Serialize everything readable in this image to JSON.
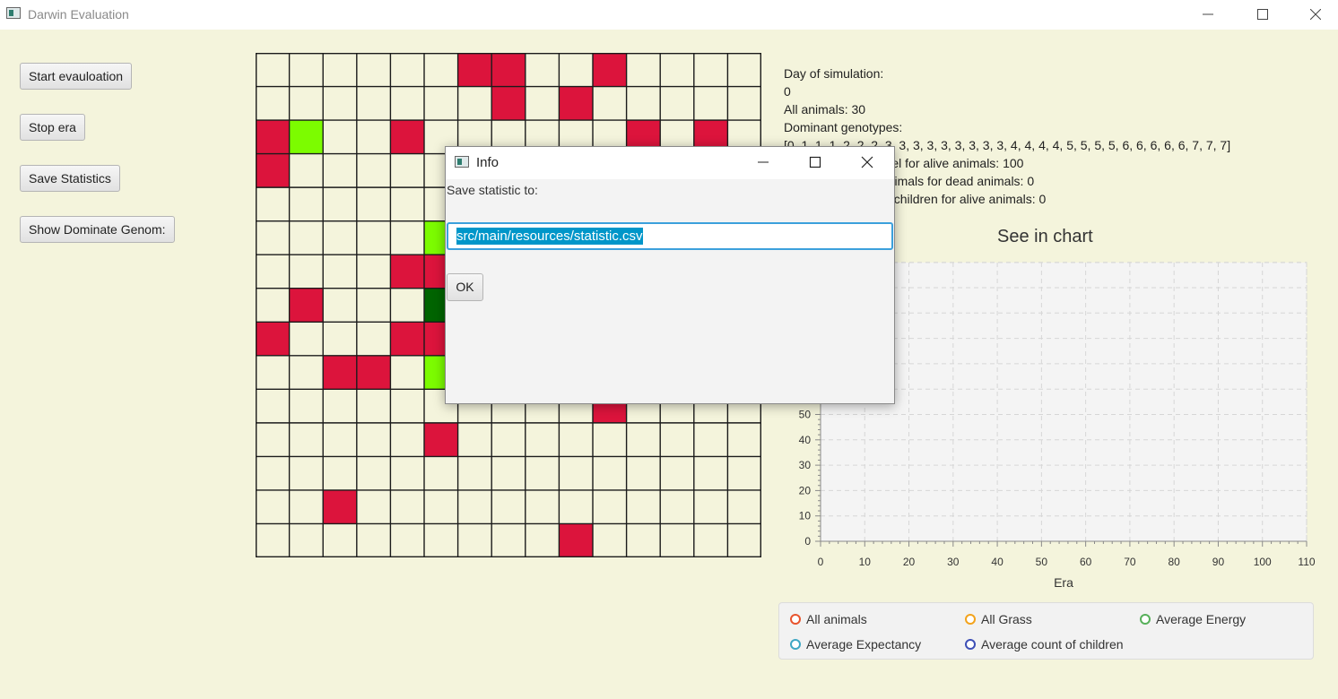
{
  "window": {
    "title": "Darwin Evaluation"
  },
  "controls": {
    "start_label": "Start evauloation",
    "stop_label": "Stop era",
    "save_label": "Save Statistics",
    "show_genom_label": "Show Dominate Genom:"
  },
  "map": {
    "columns": 15,
    "rows": 15,
    "colors": {
      "empty": "#f4f4dc",
      "animal": "#dc143c",
      "grass": "#7cfc00",
      "animal_dark": "#006400"
    },
    "animals": [
      [
        6,
        0
      ],
      [
        7,
        0
      ],
      [
        10,
        0
      ],
      [
        7,
        1
      ],
      [
        9,
        1
      ],
      [
        0,
        2
      ],
      [
        4,
        2
      ],
      [
        11,
        2
      ],
      [
        13,
        2
      ],
      [
        0,
        3
      ],
      [
        4,
        6
      ],
      [
        5,
        6
      ],
      [
        1,
        7
      ],
      [
        0,
        8
      ],
      [
        4,
        8
      ],
      [
        5,
        8
      ],
      [
        2,
        9
      ],
      [
        3,
        9
      ],
      [
        10,
        10
      ],
      [
        5,
        11
      ],
      [
        2,
        13
      ],
      [
        9,
        14
      ]
    ],
    "grass": [
      [
        1,
        2
      ],
      [
        5,
        5
      ],
      [
        5,
        9
      ]
    ],
    "dark_grass": [
      [
        5,
        7
      ]
    ]
  },
  "stats": {
    "day_label": "Day of simulation:",
    "day_value": "0",
    "all_animals": "All animals: 30",
    "dominant_label": "Dominant genotypes:",
    "dominant_value": "[0, 1, 1, 1, 2, 2, 2, 3, 3, 3, 3, 3, 3, 3, 3, 3, 4, 4, 4, 4, 5, 5, 5, 5, 6, 6, 6, 6, 6, 7, 7, 7]",
    "energy_line": "Average energy level for alive animals: 100",
    "lifespan_line": "Average lifespan animals for dead animals: 0",
    "children_line": "Average number of children for alive animals: 0"
  },
  "chart_title": "See in chart",
  "chart_data": {
    "type": "line",
    "xlabel": "Era",
    "ylabel": "",
    "xlim": [
      0,
      110
    ],
    "ylim": [
      0,
      100
    ],
    "x_ticks": [
      "0",
      "10",
      "20",
      "30",
      "40",
      "50",
      "60",
      "70",
      "80",
      "90",
      "100",
      "110"
    ],
    "y_ticks": [
      "0",
      "10",
      "20",
      "30",
      "40",
      "50"
    ],
    "grid": true,
    "legend_position": "bottom",
    "series": [
      {
        "name": "All animals",
        "color": "#e8542d",
        "values": []
      },
      {
        "name": "All Grass",
        "color": "#f3a31c",
        "values": []
      },
      {
        "name": "Average Energy",
        "color": "#57b05a",
        "values": []
      },
      {
        "name": "Average Expectancy",
        "color": "#3ea7c4",
        "values": []
      },
      {
        "name": "Average count of children",
        "color": "#3d4fb6",
        "values": []
      }
    ]
  },
  "dialog": {
    "title": "Info",
    "label": "Save statistic to:",
    "input_value": "src/main/resources/statistic.csv",
    "ok_label": "OK"
  }
}
